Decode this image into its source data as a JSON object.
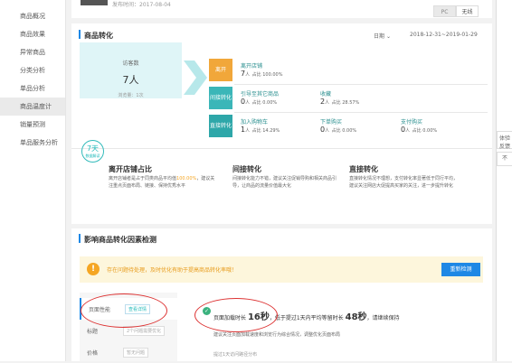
{
  "sidebar": {
    "items": [
      {
        "label": "商品概况"
      },
      {
        "label": "商品效果"
      },
      {
        "label": "异常商品"
      },
      {
        "label": "分类分析"
      },
      {
        "label": "单品分析"
      },
      {
        "label": "商品温度计"
      },
      {
        "label": "销量预测"
      },
      {
        "label": "单品服务分析"
      }
    ],
    "active_index": 5
  },
  "header": {
    "publish_time": "发布时间：2017-08-04",
    "seg_pc": "PC",
    "seg_wireless": "无线"
  },
  "conversion": {
    "title": "商品转化",
    "range_label": "日期",
    "date_range": "2018-12-31~2019-01-29",
    "visitors": {
      "label": "访客数",
      "value": "7人",
      "sub": "浏览量：1次"
    },
    "stages": [
      {
        "name": "离开",
        "color": "#f1a73a"
      },
      {
        "name": "间接转化",
        "color": "#3bb6b8"
      },
      {
        "name": "直接转化",
        "color": "#2ea7a9"
      }
    ],
    "metrics": {
      "leave": {
        "label": "离开店铺",
        "value": "7",
        "unit": "人",
        "pct": "占比 100.00%"
      },
      "other_products": {
        "label": "引导至其它商品",
        "value": "0",
        "unit": "人",
        "pct": "占比 0.00%"
      },
      "favorite": {
        "label": "收藏",
        "value": "2",
        "unit": "人",
        "pct": "占比 28.57%"
      },
      "add_cart": {
        "label": "加入购物车",
        "value": "1",
        "unit": "人",
        "pct": "占比 14.29%"
      },
      "order": {
        "label": "下单购买",
        "value": "0",
        "unit": "人",
        "pct": "占比 0.00%"
      },
      "pay": {
        "label": "支付购买",
        "value": "0",
        "unit": "人",
        "pct": "占比 0.00%"
      }
    },
    "badge": {
      "value": "7天",
      "text": "数据解读"
    },
    "explanations": [
      {
        "title": "离开店铺占比",
        "body": "离开店铺者是占于同类商品平均值",
        "highlight": "100.00%",
        "body2": "，建议关注重点页面布局、链接、保持优秀水平"
      },
      {
        "title": "间接转化",
        "body": "间接转化能力不错，建议关注促销导购和相关商品引导，让商品的流量价值最大化"
      },
      {
        "title": "直接转化",
        "body": "直接转化情况不理想，支付转化率显著低于同行平均，建议关注网店大促提高买家的关注，进一步提升转化"
      }
    ]
  },
  "factors": {
    "title": "影响商品转化因素检测",
    "warning": "存在问题待处理，及时优化有助于提高商品转化率哦！",
    "recheck_button": "重新检测",
    "tabs": [
      {
        "label": "页面性能",
        "tag": "查看详情"
      },
      {
        "label": "标题",
        "tag": "2个问题需要优化"
      },
      {
        "label": "价格",
        "tag": "暂无问题"
      }
    ],
    "result": {
      "pre": "页面加载时长",
      "load_time": "16秒",
      "mid": "，低于提过1天内平均等留时长",
      "avg_time": "48秒",
      "post": "，请继续保持"
    },
    "advice": "建议关注页面加载速度和浏览行为综合情况，调整优化页面布局",
    "sub": "提过1天访问路径分布"
  },
  "right_tools": {
    "feedback": "体验反馈",
    "collapse": "不"
  }
}
